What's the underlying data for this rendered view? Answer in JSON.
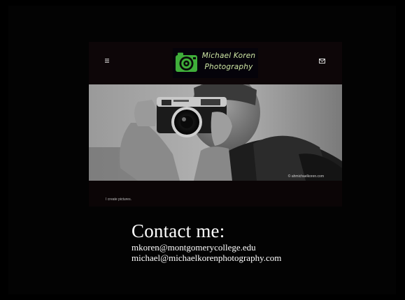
{
  "site": {
    "logo_text_line1": "Michael Koren",
    "logo_text_line2": "Photography",
    "tagline": "I create pictures.",
    "photo_credit": "© ahmichaelkoren.com",
    "icons": {
      "menu": "menu-icon",
      "mail": "mail-icon",
      "logo": "camera-icon"
    }
  },
  "contact": {
    "heading": "Contact me:",
    "emails": [
      "mkoren@montgomerycollege.edu",
      "michael@michaelkorenphotography.com"
    ]
  },
  "colors": {
    "background": "#000000",
    "frame": "#0b0506",
    "logo_green": "#3fae3a",
    "logo_text": "#cfe8a6",
    "contact_text": "#ffffff"
  }
}
